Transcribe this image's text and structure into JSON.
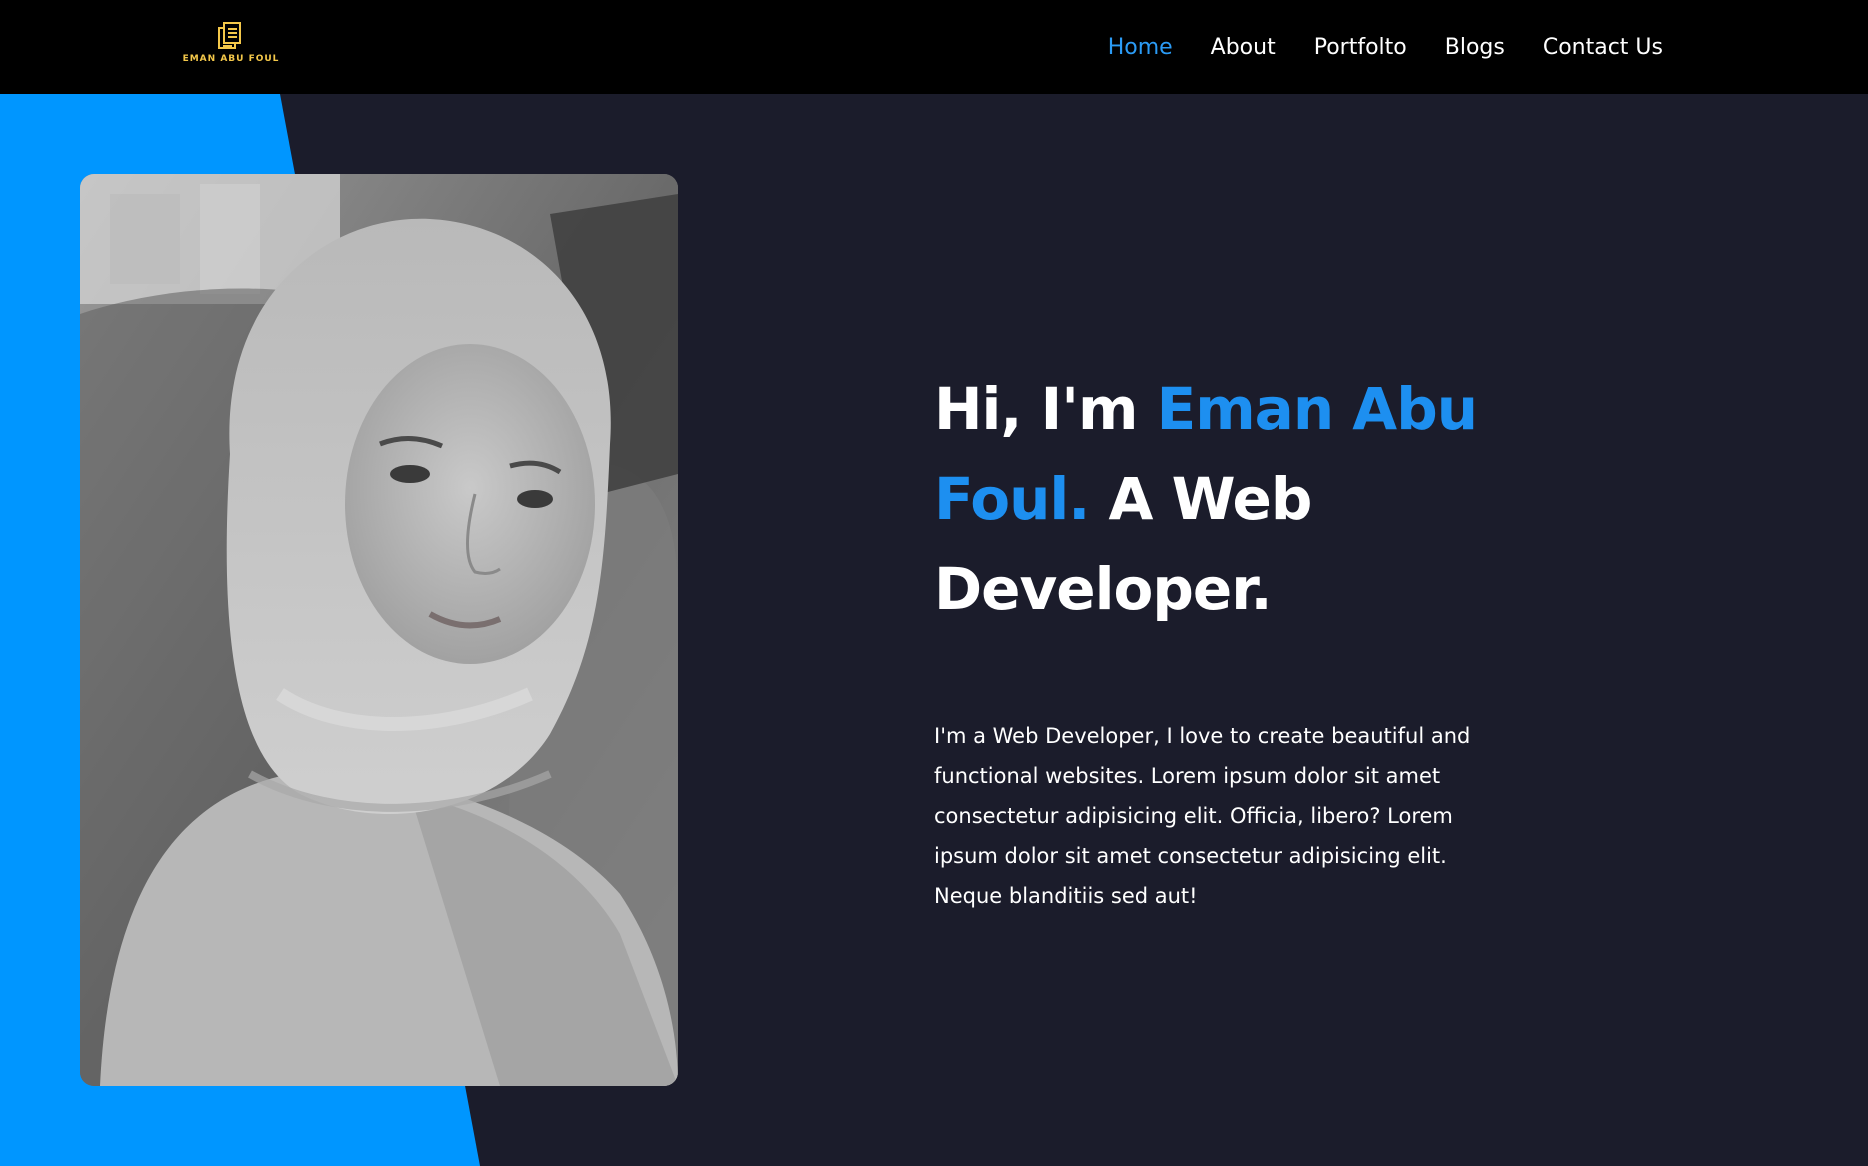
{
  "brand": {
    "logo_text": "EMAN ABU FOUL",
    "logo_color": "#f4c84a"
  },
  "nav": {
    "items": [
      {
        "label": "Home",
        "active": true
      },
      {
        "label": "About",
        "active": false
      },
      {
        "label": "Portfolto",
        "active": false
      },
      {
        "label": "Blogs",
        "active": false
      },
      {
        "label": "Contact Us",
        "active": false
      }
    ]
  },
  "hero": {
    "greeting": "Hi, I'm",
    "name": "Eman Abu Foul.",
    "role": "A Web Developer.",
    "intro": "I'm a Web Developer, I love to create beautiful and functional websites. Lorem ipsum dolor sit amet consectetur adipisicing elit. Officia, libero? Lorem ipsum dolor sit amet consectetur adipisicing elit. Neque blanditiis sed aut!",
    "photo_alt": "portrait-photo"
  },
  "colors": {
    "header_bg": "#000000",
    "page_bg": "#1b1c2b",
    "accent": "#1d8ff0",
    "shape_blue": "#0096ff",
    "text": "#ffffff"
  }
}
